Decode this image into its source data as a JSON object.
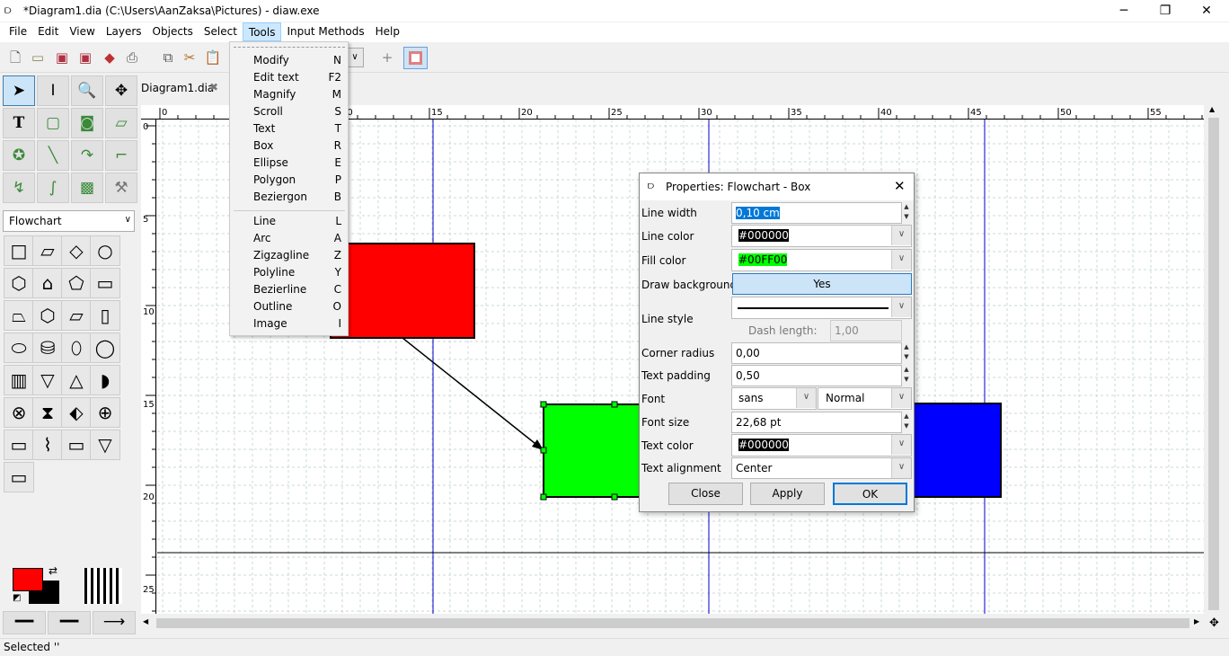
{
  "window": {
    "title": "*Diagram1.dia (C:\\Users\\AanZaksa\\Pictures) - diaw.exe",
    "minimize": "─",
    "maximize": "❐",
    "close": "✕"
  },
  "menubar": [
    "File",
    "Edit",
    "View",
    "Layers",
    "Objects",
    "Select",
    "Tools",
    "Input Methods",
    "Help"
  ],
  "tab": {
    "label": "Diagram1.dia",
    "close": "✖"
  },
  "sheet": {
    "selected": "Flowchart"
  },
  "tools_menu": [
    {
      "label": "Modify",
      "key": "N"
    },
    {
      "label": "Edit text",
      "key": "F2"
    },
    {
      "label": "Magnify",
      "key": "M"
    },
    {
      "label": "Scroll",
      "key": "S"
    },
    {
      "label": "Text",
      "key": "T"
    },
    {
      "label": "Box",
      "key": "R"
    },
    {
      "label": "Ellipse",
      "key": "E"
    },
    {
      "label": "Polygon",
      "key": "P"
    },
    {
      "label": "Beziergon",
      "key": "B"
    },
    {
      "label": "Line",
      "key": "L"
    },
    {
      "label": "Arc",
      "key": "A"
    },
    {
      "label": "Zigzagline",
      "key": "Z"
    },
    {
      "label": "Polyline",
      "key": "Y"
    },
    {
      "label": "Bezierline",
      "key": "C"
    },
    {
      "label": "Outline",
      "key": "O"
    },
    {
      "label": "Image",
      "key": "I"
    }
  ],
  "ruler": {
    "h_labels": [
      "0",
      "5",
      "10",
      "15",
      "20",
      "25",
      "30",
      "35",
      "40",
      "45",
      "50",
      "55"
    ],
    "v_labels": [
      "0",
      "5",
      "10",
      "15",
      "20",
      "25"
    ]
  },
  "colors": {
    "foreground": "#FF0000",
    "background": "#000000",
    "shape1": "#FF0000",
    "shape2": "#00FF00",
    "shape3": "#0000FF",
    "guide": "#0000CC"
  },
  "dialog": {
    "title": "Properties: Flowchart - Box",
    "close": "✕",
    "line_width_label": "Line width",
    "line_width": "0,10 cm",
    "line_color_label": "Line color",
    "line_color": "#000000",
    "fill_color_label": "Fill color",
    "fill_color": "#00FF00",
    "draw_bg_label": "Draw background",
    "draw_bg": "Yes",
    "line_style_label": "Line style",
    "dash_label": "Dash length:",
    "dash": "1,00",
    "corner_label": "Corner radius",
    "corner": "0,00",
    "padding_label": "Text padding",
    "padding": "0,50",
    "font_label": "Font",
    "font": "sans",
    "font_style": "Normal",
    "font_size_label": "Font size",
    "font_size": "22,68 pt",
    "text_color_label": "Text color",
    "text_color": "#000000",
    "align_label": "Text alignment",
    "align": "Center",
    "close_btn": "Close",
    "apply_btn": "Apply",
    "ok_btn": "OK"
  },
  "status": "Selected ''"
}
